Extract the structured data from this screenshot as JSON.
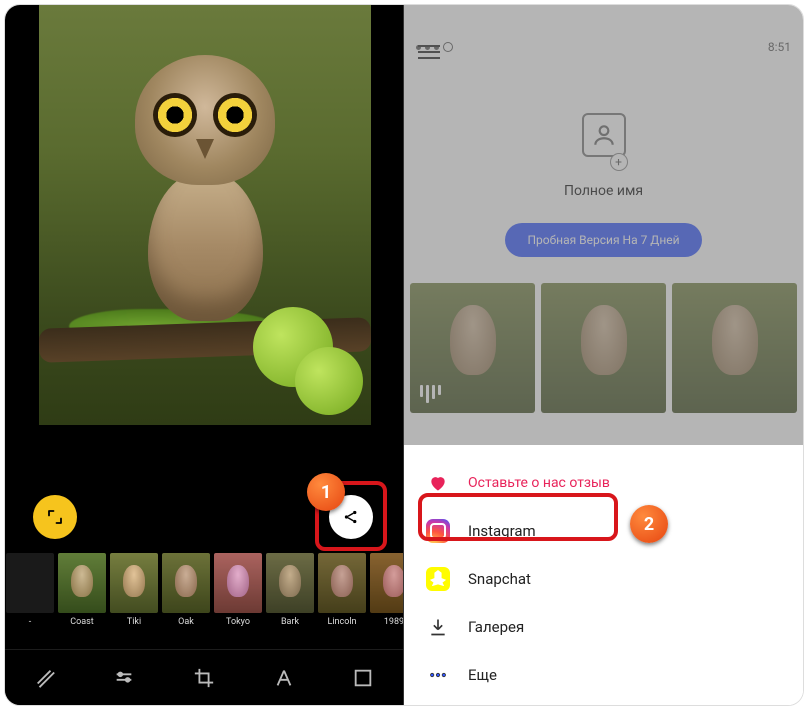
{
  "statusbar": {
    "time": "8:51"
  },
  "left": {
    "filters": [
      {
        "id": "none",
        "label": "-"
      },
      {
        "id": "coast",
        "label": "Coast"
      },
      {
        "id": "tiki",
        "label": "Tiki"
      },
      {
        "id": "oak",
        "label": "Oak"
      },
      {
        "id": "tokyo",
        "label": "Tokyo"
      },
      {
        "id": "bark",
        "label": "Bark"
      },
      {
        "id": "lincoln",
        "label": "Lincoln"
      },
      {
        "id": "1989",
        "label": "1989"
      }
    ],
    "annotations": {
      "step1": "1"
    }
  },
  "right": {
    "profile": {
      "name_placeholder": "Полное имя",
      "trial_button": "Пробная Версия На 7 Дней"
    },
    "share_sheet": {
      "review": "Оставьте о нас отзыв",
      "instagram": "Instagram",
      "snapchat": "Snapchat",
      "gallery": "Галерея",
      "more": "Еще"
    },
    "annotations": {
      "step2": "2"
    }
  }
}
